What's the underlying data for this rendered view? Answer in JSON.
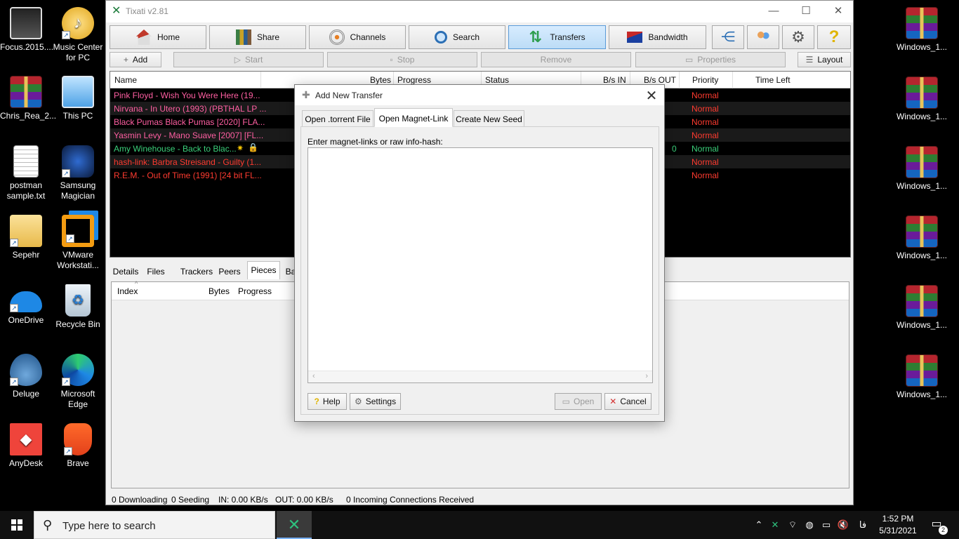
{
  "desktop": {
    "left_icons": [
      {
        "label": "Focus.2015....",
        "icon": "video-file-icon"
      },
      {
        "label": "Music Center for PC",
        "icon": "music-note-icon"
      },
      {
        "label": "Chris_Rea_2...",
        "icon": "winrar-archive-icon"
      },
      {
        "label": "This PC",
        "icon": "computer-icon"
      },
      {
        "label": "postman sample.txt",
        "icon": "text-file-icon"
      },
      {
        "label": "Samsung Magician",
        "icon": "samsung-magician-icon"
      },
      {
        "label": "Sepehr",
        "icon": "folder-icon"
      },
      {
        "label": "VMware Workstati...",
        "icon": "vmware-icon"
      },
      {
        "label": "OneDrive",
        "icon": "cloud-icon"
      },
      {
        "label": "Recycle Bin",
        "icon": "recycle-bin-icon"
      },
      {
        "label": "Deluge",
        "icon": "deluge-icon"
      },
      {
        "label": "Microsoft Edge",
        "icon": "edge-icon"
      },
      {
        "label": "AnyDesk",
        "icon": "anydesk-icon"
      },
      {
        "label": "Brave",
        "icon": "brave-icon"
      }
    ],
    "right_icons": [
      {
        "label": "Windows_1..."
      },
      {
        "label": "Windows_1..."
      },
      {
        "label": "Windows_1..."
      },
      {
        "label": "Windows_1..."
      },
      {
        "label": "Windows_1..."
      },
      {
        "label": "Windows_1..."
      }
    ]
  },
  "window": {
    "title": "Tixati v2.81",
    "minimize": "—",
    "maximize": "☐",
    "close": "✕"
  },
  "nav": {
    "home": "Home",
    "share": "Share",
    "channels": "Channels",
    "search": "Search",
    "transfers": "Transfers",
    "bandwidth": "Bandwidth"
  },
  "toolbar": {
    "add": "Add",
    "start": "Start",
    "stop": "Stop",
    "remove": "Remove",
    "properties": "Properties",
    "layout": "Layout"
  },
  "transfers": {
    "columns": [
      "Name",
      "Bytes",
      "Progress",
      "Status",
      "B/s IN",
      "B/s OUT",
      "Priority",
      "Time Left"
    ],
    "rows": [
      {
        "name": "Pink Floyd  - Wish You Were Here (19...",
        "priority": "Normal",
        "color": "#ff5fa2",
        "out": ""
      },
      {
        "name": "Nirvana - In Utero (1993) (PBTHAL LP ...",
        "priority": "Normal",
        "color": "#ff5fa2",
        "out": ""
      },
      {
        "name": "Black Pumas Black Pumas [2020] FLA...",
        "priority": "Normal",
        "color": "#ff5fa2",
        "out": ""
      },
      {
        "name": "Yasmin Levy - Mano Suave [2007] [FL...",
        "priority": "Normal",
        "color": "#ff5fa2",
        "out": ""
      },
      {
        "name": "Amy Winehouse - Back to Blac...",
        "priority": "Normal",
        "color": "#3ad07a",
        "out": "0"
      },
      {
        "name": "hash-link: Barbra Streisand - Guilty (1...",
        "priority": "Normal",
        "color": "#ff3b30",
        "out": ""
      },
      {
        "name": "R.E.M. - Out of Time (1991) [24 bit FL...",
        "priority": "Normal",
        "color": "#ff3b30",
        "out": ""
      }
    ]
  },
  "detail_tabs": [
    "Details",
    "Files",
    "Trackers",
    "Peers",
    "Pieces",
    "Ba"
  ],
  "pieces": {
    "columns": [
      "Index",
      "Bytes",
      "Progress"
    ]
  },
  "status": {
    "downloading": "0 Downloading",
    "seeding": "0 Seeding",
    "in": "IN: 0.00 KB/s",
    "out": "OUT: 0.00 KB/s",
    "incoming": "0 Incoming Connections Received"
  },
  "dialog": {
    "title": "Add New Transfer",
    "close": "✕",
    "tabs": [
      "Open .torrent File",
      "Open Magnet-Link",
      "Create New Seed"
    ],
    "active_tab": "Open Magnet-Link",
    "prompt": "Enter magnet-links or raw info-hash:",
    "input_value": "",
    "help": "Help",
    "settings": "Settings",
    "open": "Open",
    "cancel": "Cancel"
  },
  "taskbar": {
    "search_placeholder": "Type here to search",
    "time": "1:52 PM",
    "date": "5/31/2021",
    "language": "فا",
    "notifications": "2"
  },
  "colors": {
    "accent": "#5a9bd8",
    "priority": "#ff3b30",
    "pink": "#ff5fa2",
    "green": "#3ad07a"
  }
}
